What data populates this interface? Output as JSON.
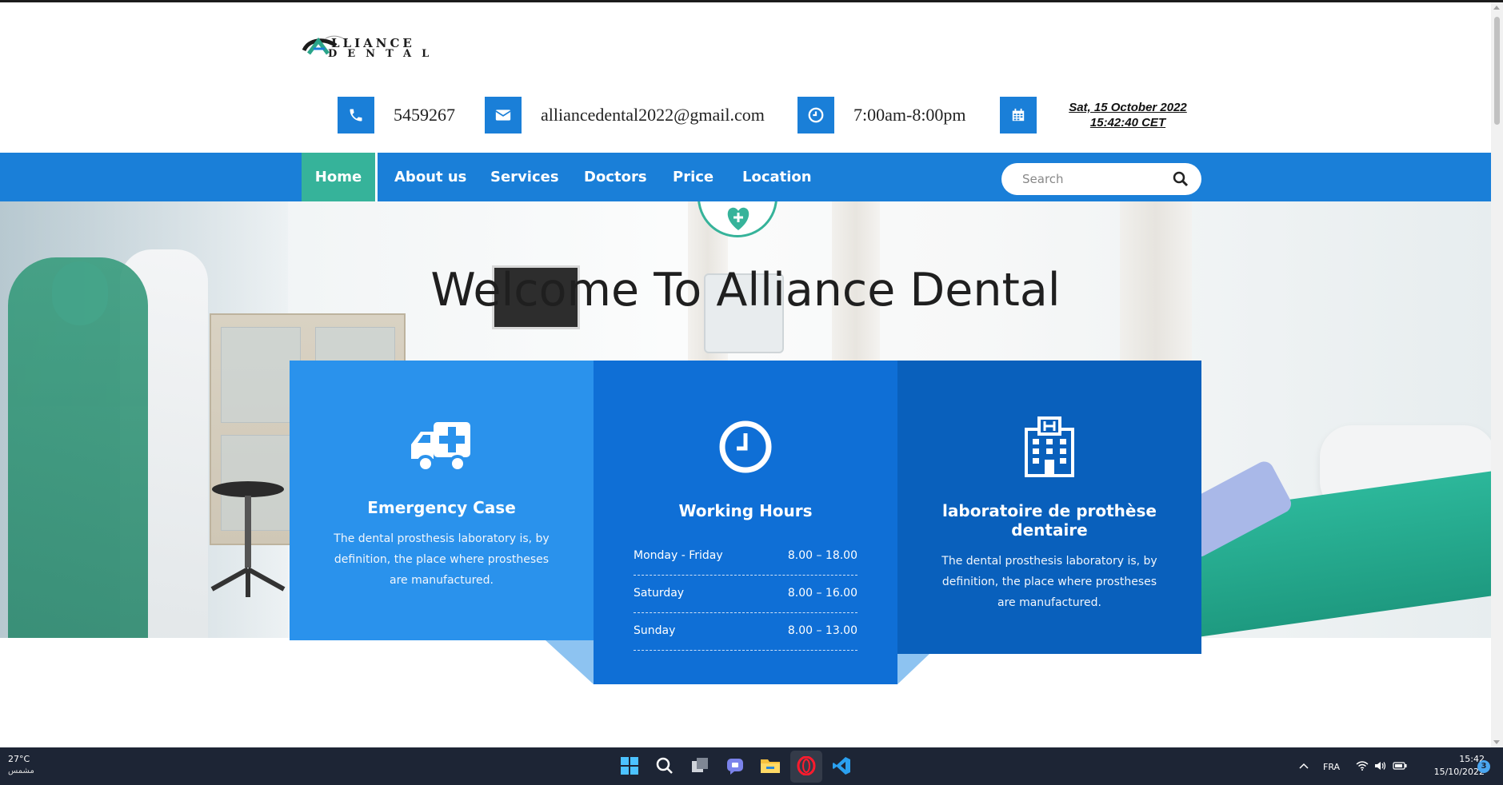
{
  "logo": {
    "line1": "LLIANCE",
    "line2": "DENTAL"
  },
  "contact": {
    "phone": "5459267",
    "email": "alliancedental2022@gmail.com",
    "hours": "7:00am-8:00pm",
    "date_line1": "Sat, 15 October 2022",
    "date_line2": "15:42:40 CET"
  },
  "nav": {
    "items": [
      "Home",
      "About us",
      "Services",
      "Doctors",
      "Price",
      "Location"
    ],
    "search_placeholder": "Search"
  },
  "hero": {
    "title": "Welcome To Alliance Dental"
  },
  "cards": [
    {
      "title": "Emergency Case",
      "text": "The dental prosthesis laboratory is, by definition, the place where prostheses are manufactured."
    },
    {
      "title": "Working Hours",
      "rows": [
        {
          "day": "Monday - Friday",
          "time": "8.00 – 18.00"
        },
        {
          "day": "Saturday",
          "time": "8.00 – 16.00"
        },
        {
          "day": "Sunday",
          "time": "8.00 – 13.00"
        }
      ]
    },
    {
      "title": "laboratoire de prothèse dentaire",
      "text": "The dental prosthesis laboratory is, by definition, the place where prostheses are manufactured."
    }
  ],
  "taskbar": {
    "weather_temp": "27°C",
    "weather_desc": "مشمس",
    "language": "FRA",
    "time": "15:42",
    "date": "15/10/2022",
    "notifications": "3",
    "icons": [
      "windows-start-icon",
      "search-icon",
      "task-view-icon",
      "teams-chat-icon",
      "file-explorer-icon",
      "opera-icon",
      "vscode-icon"
    ]
  },
  "colors": {
    "primary": "#1a7fd8",
    "accent": "#36b39a",
    "card1": "#2a92ec",
    "card2": "#0f6fd6",
    "card3": "#0960bc"
  }
}
